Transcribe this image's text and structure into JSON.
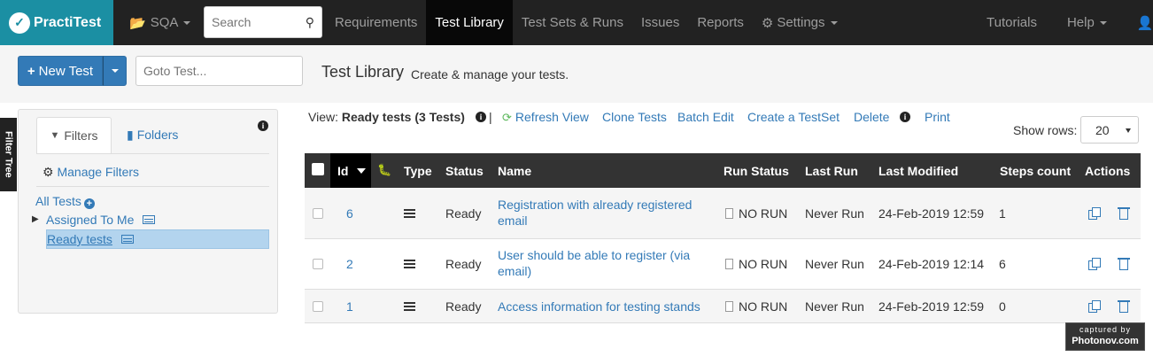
{
  "nav": {
    "brand": "PractiTest",
    "project": "SQA",
    "search_placeholder": "Search",
    "items": [
      "Requirements",
      "Test Library",
      "Test Sets & Runs",
      "Issues",
      "Reports"
    ],
    "settings": "Settings",
    "tutorials": "Tutorials",
    "help": "Help"
  },
  "toolbar": {
    "new_test": "New Test",
    "goto_placeholder": "Goto Test...",
    "title": "Test Library",
    "subtitle": "Create & manage your tests."
  },
  "side_tab": "Filter Tree",
  "panel": {
    "tab_filters": "Filters",
    "tab_folders": "Folders",
    "manage_filters": "Manage Filters",
    "all_tests": "All Tests",
    "assigned_to_me": "Assigned To Me",
    "ready_tests": "Ready tests"
  },
  "view": {
    "prefix": "View:",
    "name": "Ready tests (3 Tests)",
    "refresh": "Refresh View",
    "clone": "Clone Tests",
    "batch_edit": "Batch Edit",
    "create_testset": "Create a TestSet",
    "delete": "Delete",
    "print": "Print",
    "show_rows_label": "Show rows:",
    "show_rows_value": "20"
  },
  "table": {
    "headers": {
      "id": "Id",
      "type": "Type",
      "status": "Status",
      "name": "Name",
      "run_status": "Run Status",
      "last_run": "Last Run",
      "last_modified": "Last Modified",
      "steps_count": "Steps count",
      "actions": "Actions"
    },
    "rows": [
      {
        "id": "6",
        "status": "Ready",
        "name_l1": "Registration with already registered",
        "name_l2": "email",
        "run_status": "NO RUN",
        "last_run": "Never Run",
        "last_modified": "24-Feb-2019 12:59",
        "steps": "1"
      },
      {
        "id": "2",
        "status": "Ready",
        "name_l1": "User should be able to register (via",
        "name_l2": "email)",
        "run_status": "NO RUN",
        "last_run": "Never Run",
        "last_modified": "24-Feb-2019 12:14",
        "steps": "6"
      },
      {
        "id": "1",
        "status": "Ready",
        "name_l1": "Access information for testing stands",
        "name_l2": "",
        "run_status": "NO RUN",
        "last_run": "Never Run",
        "last_modified": "24-Feb-2019 12:59",
        "steps": "0"
      }
    ]
  },
  "watermark": {
    "line1": "captured by",
    "line2": "Photonov.com"
  }
}
